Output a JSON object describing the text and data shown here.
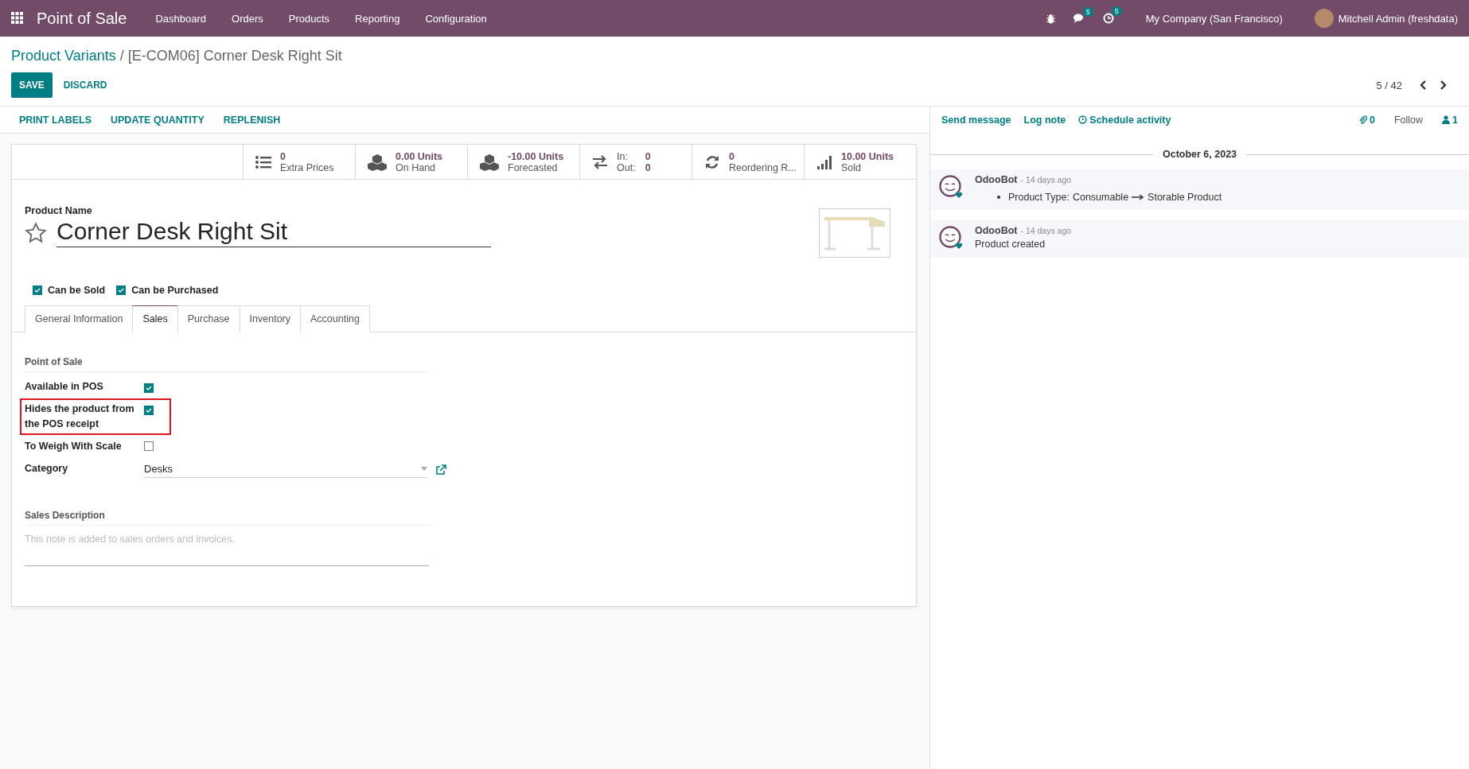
{
  "navbar": {
    "app_title": "Point of Sale",
    "menu": [
      "Dashboard",
      "Orders",
      "Products",
      "Reporting",
      "Configuration"
    ],
    "messages_badge": "5",
    "activities_badge": "5",
    "company": "My Company (San Francisco)",
    "user": "Mitchell Admin (freshdata)"
  },
  "breadcrumb": {
    "parent": "Product Variants",
    "separator": "/",
    "current": "[E-COM06] Corner Desk Right Sit"
  },
  "buttons": [
    {
      "label": "SAVE",
      "kind": "primary"
    },
    {
      "label": "DISCARD",
      "kind": "link"
    }
  ],
  "pager": "5 / 42",
  "actions": [
    "PRINT LABELS",
    "UPDATE QUANTITY",
    "REPLENISH"
  ],
  "smart_buttons": [
    {
      "kind": "list",
      "value": "0",
      "label": "Extra Prices"
    },
    {
      "kind": "cubes",
      "value": "0.00 Units",
      "label": "On Hand"
    },
    {
      "kind": "cubes",
      "value": "-10.00 Units",
      "label": "Forecasted"
    },
    {
      "kind": "in_out",
      "in_label": "In:",
      "in_value": "0",
      "out_label": "Out:",
      "out_value": "0"
    },
    {
      "kind": "refresh",
      "value": "0",
      "label": "Reordering R..."
    },
    {
      "kind": "signal",
      "value": "10.00 Units",
      "label": "Sold"
    }
  ],
  "form": {
    "name_label": "Product Name",
    "name": "Corner Desk Right Sit",
    "favorite": false,
    "options": [
      {
        "label": "Can be Sold",
        "checked": true
      },
      {
        "label": "Can be Purchased",
        "checked": true
      }
    ],
    "tabs": [
      {
        "label": "General Information",
        "selected": false
      },
      {
        "label": "Sales",
        "selected": true
      },
      {
        "label": "Purchase",
        "selected": false
      },
      {
        "label": "Inventory",
        "selected": false
      },
      {
        "label": "Accounting",
        "selected": false
      }
    ],
    "section_title": "Point of Sale",
    "fields": [
      {
        "kind": "checkbox",
        "label": "Available in POS",
        "checked": true,
        "highlighted": false
      },
      {
        "kind": "checkbox",
        "label": "Hides the product from the POS receipt",
        "checked": true,
        "highlighted": true
      },
      {
        "kind": "checkbox",
        "label": "To Weigh With Scale",
        "checked": false,
        "highlighted": false
      },
      {
        "kind": "select",
        "label": "Category",
        "value": "Desks",
        "highlighted": false
      }
    ],
    "description_title": "Sales Description",
    "description_placeholder": "This note is added to sales orders and invoices."
  },
  "chatter": {
    "actions": [
      "Send message",
      "Log note",
      "Schedule activity"
    ],
    "attachments": "0",
    "follow": "Follow",
    "followers": "1",
    "date": "October 6, 2023",
    "messages": [
      {
        "kind": "tracking",
        "author": "OdooBot",
        "time": "- 14 days ago",
        "field": "Product Type:",
        "old": "Consumable",
        "new": "Storable Product"
      },
      {
        "kind": "text",
        "author": "OdooBot",
        "time": "- 14 days ago",
        "body": "Product created"
      }
    ]
  }
}
